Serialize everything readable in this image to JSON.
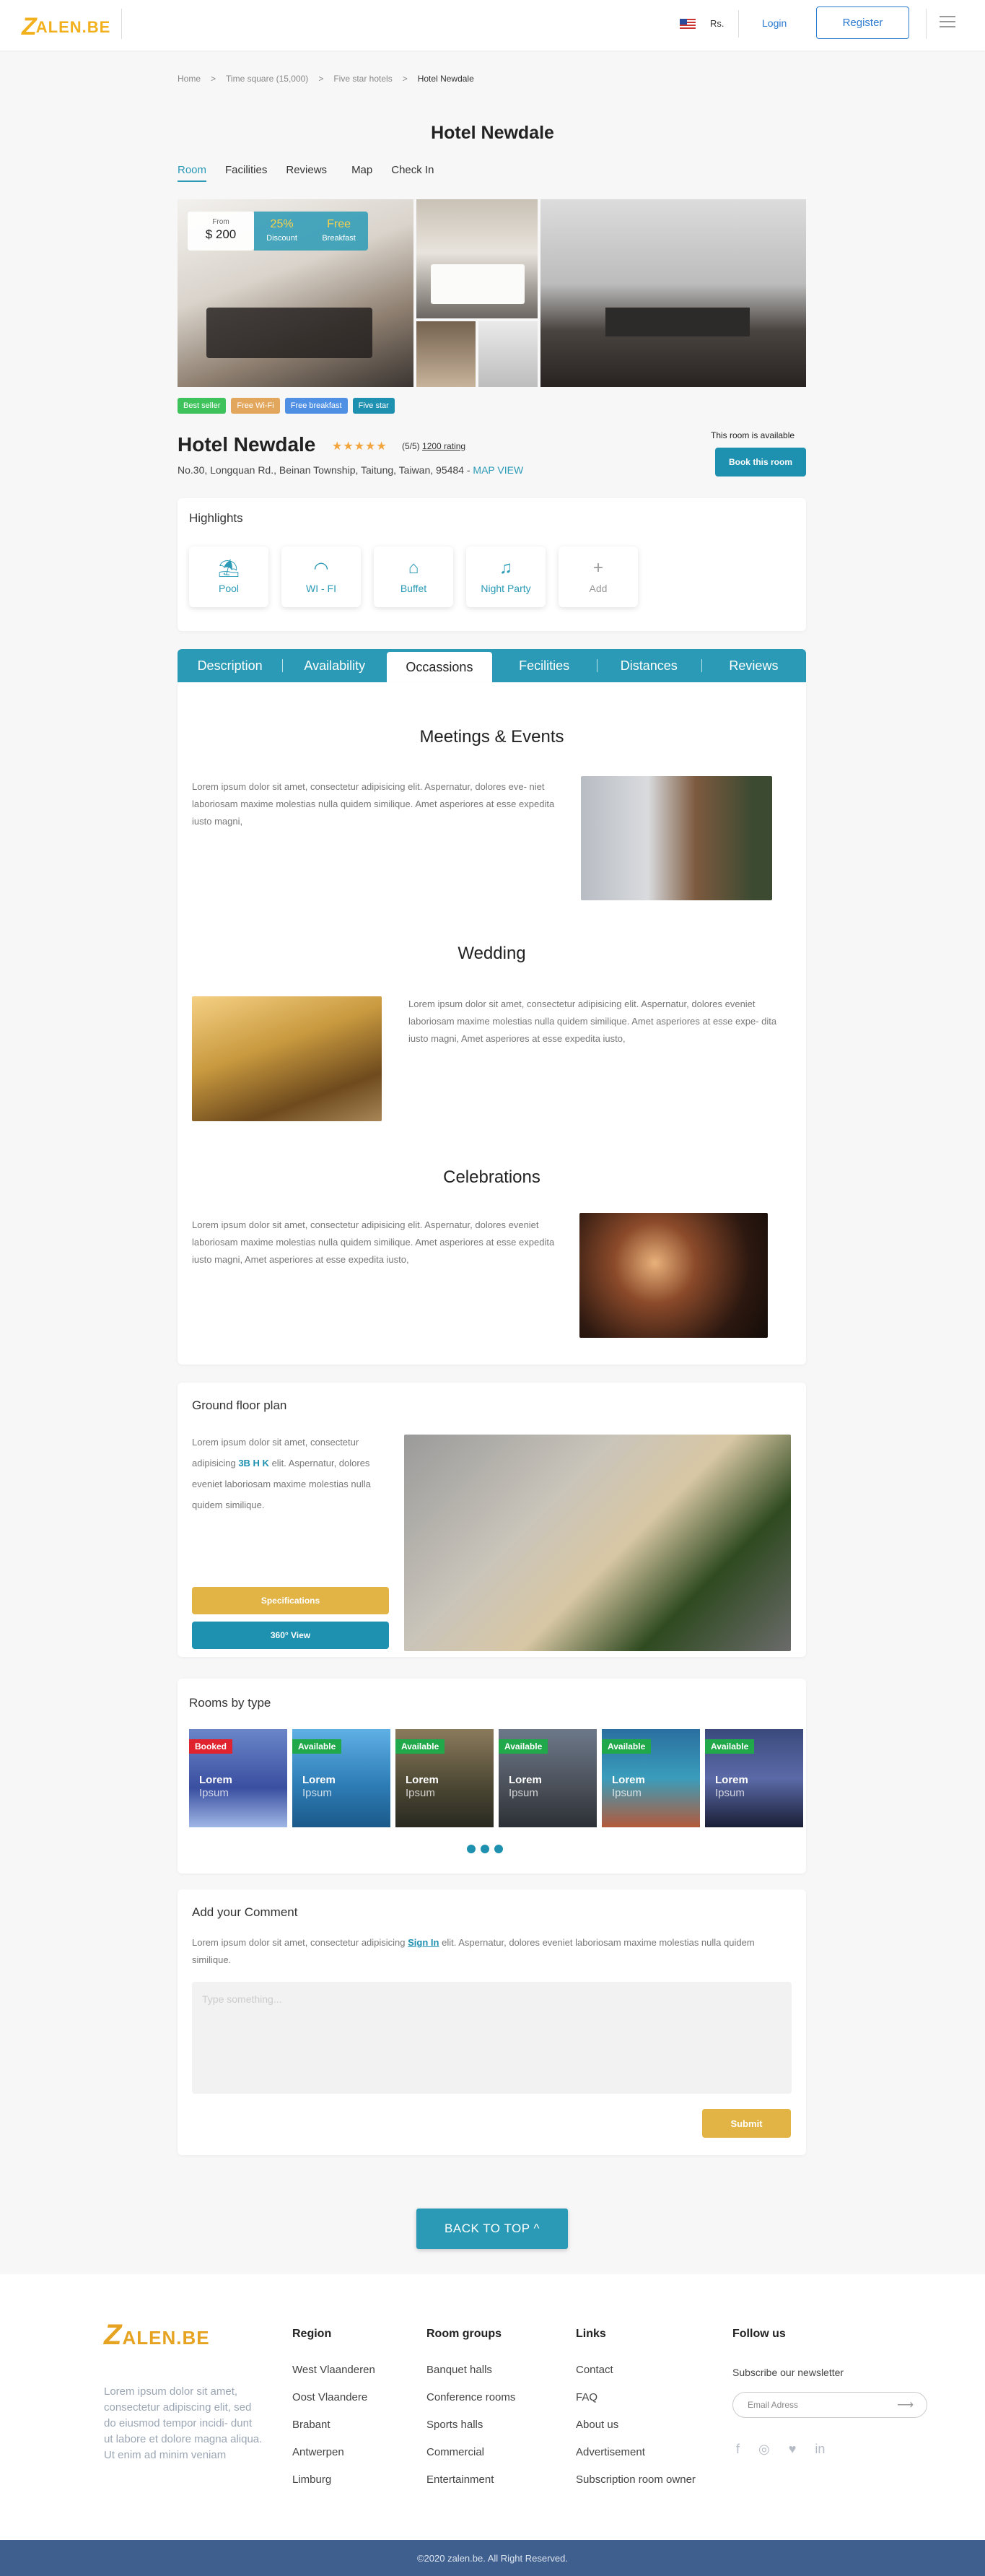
{
  "header": {
    "logo": "ALEN.BE",
    "logo_letter": "Z",
    "currency": "Rs.",
    "login": "Login",
    "register": "Register"
  },
  "breadcrumb": [
    "Home",
    ">",
    "Time square (15,000)",
    ">",
    "Five star hotels",
    ">",
    "Hotel Newdale"
  ],
  "page_title": "Hotel Newdale",
  "subnav": [
    "Room",
    "Facilities",
    "Reviews",
    "Map",
    "Check In"
  ],
  "gallery": {
    "price_from": "From",
    "price": "$ 200",
    "promo_percent": "25%",
    "promo_label": "Discount",
    "promo_free": "Free",
    "promo_free_label": "Breakfast"
  },
  "tags": [
    {
      "label": "Best seller",
      "color": "#3ec35c"
    },
    {
      "label": "Free Wi-Fi",
      "color": "#e2a75c"
    },
    {
      "label": "Free breakfast",
      "color": "#4f8fe4"
    },
    {
      "label": "Five star",
      "color": "#1e90b0"
    }
  ],
  "hotel": {
    "name": "Hotel Newdale",
    "stars": "★★★★★",
    "rating": "(5/5)",
    "rating_count": "1200 rating",
    "address": "No.30, Longquan Rd., Beinan Township, Taitung, Taiwan, 95484 - ",
    "map_link": "MAP VIEW",
    "availability": "This room is available",
    "book": "Book this room"
  },
  "highlights": {
    "title": "Highlights",
    "items": [
      {
        "label": "Pool",
        "icon": "pool-icon"
      },
      {
        "label": "WI - FI",
        "icon": "wifi-icon"
      },
      {
        "label": "Buffet",
        "icon": "buffet-icon"
      },
      {
        "label": "Night Party",
        "icon": "party-icon"
      },
      {
        "label": "Add",
        "icon": "plus-icon"
      }
    ]
  },
  "tabs": [
    "Description",
    "Availability",
    "Occassions",
    "Fecilities",
    "Distances",
    "Reviews"
  ],
  "occasions": {
    "meetings": {
      "title": "Meetings & Events",
      "text": "Lorem ipsum dolor sit amet, consectetur adipisicing elit. Aspernatur, dolores eve- niet laboriosam maxime molestias nulla quidem similique. Amet asperiores at esse expedita iusto magni,"
    },
    "wedding": {
      "title": "Wedding",
      "text": "Lorem ipsum dolor sit amet, consectetur adipisicing elit. Aspernatur, dolores eveniet laboriosam maxime molestias nulla quidem similique. Amet asperiores at esse expe- dita iusto magni, Amet asperiores at esse expedita iusto,"
    },
    "celebrations": {
      "title": "Celebrations",
      "text": "Lorem ipsum dolor sit amet, consectetur adipisicing elit. Aspernatur, dolores eveniet laboriosam maxime molestias nulla quidem similique. Amet asperiores at esse expedita iusto magni, Amet asperiores at esse expedita iusto,"
    }
  },
  "floor": {
    "title": "Ground floor plan",
    "text_a": "Lorem ipsum dolor sit amet, consectetur adipisicing ",
    "bhk": "3B H K",
    "text_b": " elit. Aspernatur, dolores eveniet laboriosam maxime molestias nulla quidem similique.",
    "specs": "Specifications",
    "view360": "360° View"
  },
  "rooms": {
    "title": "Rooms by type",
    "items": [
      {
        "status": "Booked",
        "color": "#e0242f",
        "t1": "Lorem",
        "t2": "Ipsum"
      },
      {
        "status": "Available",
        "color": "#21a84a",
        "t1": "Lorem",
        "t2": "Ipsum"
      },
      {
        "status": "Available",
        "color": "#21a84a",
        "t1": "Lorem",
        "t2": "Ipsum"
      },
      {
        "status": "Available",
        "color": "#21a84a",
        "t1": "Lorem",
        "t2": "Ipsum"
      },
      {
        "status": "Available",
        "color": "#21a84a",
        "t1": "Lorem",
        "t2": "Ipsum"
      },
      {
        "status": "Available",
        "color": "#21a84a",
        "t1": "Lorem",
        "t2": "Ipsum"
      }
    ]
  },
  "comment": {
    "title": "Add your Comment",
    "text_a": "Lorem ipsum dolor sit amet, consectetur adipisicing ",
    "signin": "Sign In",
    "text_b": " elit. Aspernatur, dolores eveniet laboriosam maxime molestias nulla quidem similique.",
    "placeholder": "Type something...",
    "submit": "Submit"
  },
  "back_to_top": "BACK TO TOP  ^",
  "footer": {
    "logo": "ALEN.BE",
    "logo_letter": "Z",
    "desc": "Lorem ipsum dolor sit amet, consectetur adipiscing elit, sed do eiusmod tempor incidi- dunt ut labore et dolore magna aliqua. Ut enim ad minim veniam",
    "cols": [
      {
        "title": "Region",
        "items": [
          "West Vlaanderen",
          "Oost Vlaandere",
          "Brabant",
          "Antwerpen",
          "Limburg"
        ]
      },
      {
        "title": "Room groups",
        "items": [
          "Banquet halls",
          "Conference rooms",
          "Sports halls",
          "Commercial",
          "Entertainment"
        ]
      },
      {
        "title": "Links",
        "items": [
          "Contact",
          "FAQ",
          "About us",
          "Advertisement",
          "Subscription room owner"
        ]
      }
    ],
    "follow": "Follow us",
    "newsletter": "Subscribe our newsletter",
    "email_placeholder": "Email Adress",
    "social": [
      "f",
      "◎",
      "♥",
      "in"
    ],
    "copyright": "©2020 zalen.be. All Right Reserved."
  }
}
